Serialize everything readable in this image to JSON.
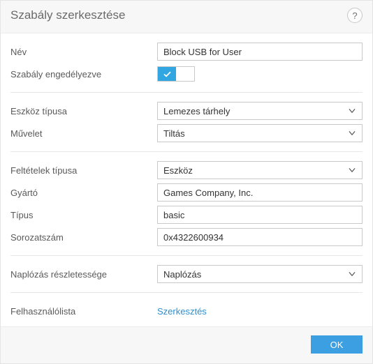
{
  "title": "Szabály szerkesztése",
  "help_tooltip": "?",
  "fields": {
    "name_label": "Név",
    "name_value": "Block USB for User",
    "enabled_label": "Szabály engedélyezve",
    "enabled_value": true,
    "device_type_label": "Eszköz típusa",
    "device_type_value": "Lemezes tárhely",
    "action_label": "Művelet",
    "action_value": "Tiltás",
    "criteria_type_label": "Feltételek típusa",
    "criteria_type_value": "Eszköz",
    "vendor_label": "Gyártó",
    "vendor_value": "Games Company, Inc.",
    "model_label": "Típus",
    "model_value": "basic",
    "serial_label": "Sorozatszám",
    "serial_value": "0x4322600934",
    "log_level_label": "Naplózás részletessége",
    "log_level_value": "Naplózás",
    "userlist_label": "Felhasználólista",
    "userlist_link": "Szerkesztés"
  },
  "buttons": {
    "ok": "OK"
  }
}
